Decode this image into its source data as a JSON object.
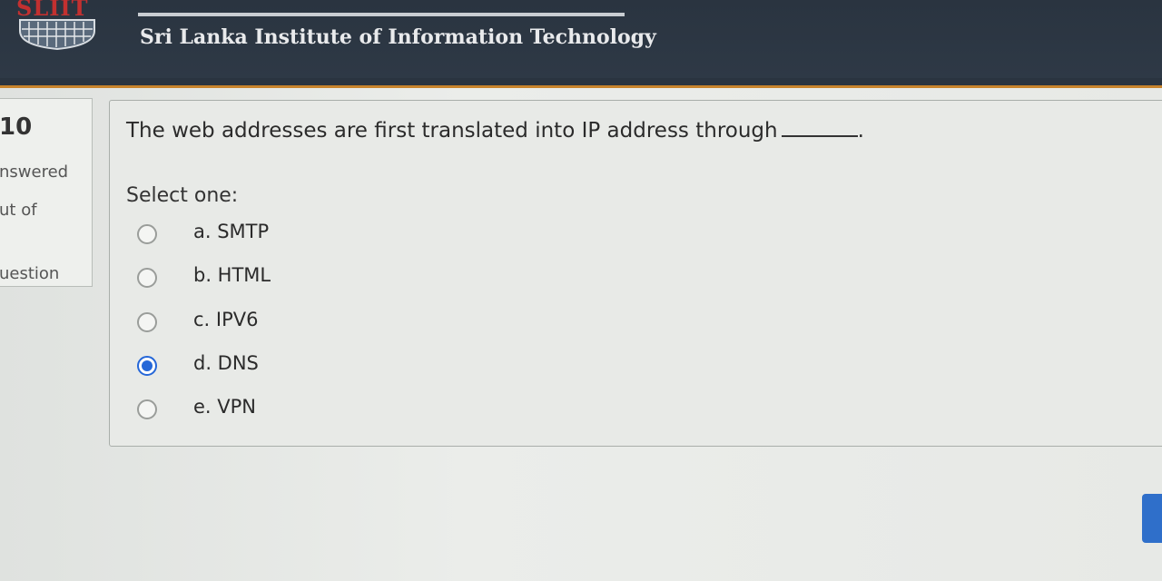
{
  "header": {
    "logo_text": "SLIIT",
    "institute_name": "Sri Lanka Institute of Information Technology"
  },
  "info": {
    "question_number": "10",
    "status": "nswered",
    "mark": "ut of",
    "flag": "uestion"
  },
  "question": {
    "text": "The web addresses are first translated into IP address through",
    "suffix": ".",
    "prompt": "Select one:",
    "options": [
      {
        "label": "a. SMTP",
        "selected": false
      },
      {
        "label": "b. HTML",
        "selected": false
      },
      {
        "label": "c. IPV6",
        "selected": false
      },
      {
        "label": "d. DNS",
        "selected": true
      },
      {
        "label": "e. VPN",
        "selected": false
      }
    ]
  },
  "colors": {
    "header_bg": "#2a3440",
    "accent": "#c8842c",
    "radio_selected": "#2567d8",
    "button": "#2f6fca"
  }
}
